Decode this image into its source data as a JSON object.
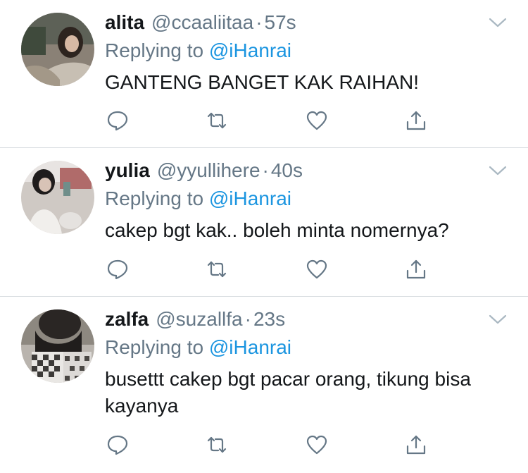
{
  "tweets": [
    {
      "name": "alita",
      "handle": "@ccaaliitaa",
      "separator": "·",
      "time": "57s",
      "replying_prefix": "Replying to",
      "replying_to": "@iHanrai",
      "text": "GANTENG BANGET KAK RAIHAN!"
    },
    {
      "name": "yulia",
      "handle": "@yyullihere",
      "separator": "·",
      "time": "40s",
      "replying_prefix": "Replying to",
      "replying_to": "@iHanrai",
      "text": "cakep bgt kak.. boleh minta nomernya?"
    },
    {
      "name": "zalfa",
      "handle": "@suzallfa",
      "separator": "·",
      "time": "23s",
      "replying_prefix": "Replying to",
      "replying_to": "@iHanrai",
      "text": "busettt cakep bgt pacar orang, tikung bisa kayanya"
    }
  ],
  "icons": {
    "reply": "reply-icon",
    "retweet": "retweet-icon",
    "like": "heart-icon",
    "share": "share-icon",
    "menu": "chevron-down-icon"
  },
  "colors": {
    "text": "#14171a",
    "muted": "#657786",
    "mention": "#1b95e0",
    "divider": "#d9dde1"
  }
}
